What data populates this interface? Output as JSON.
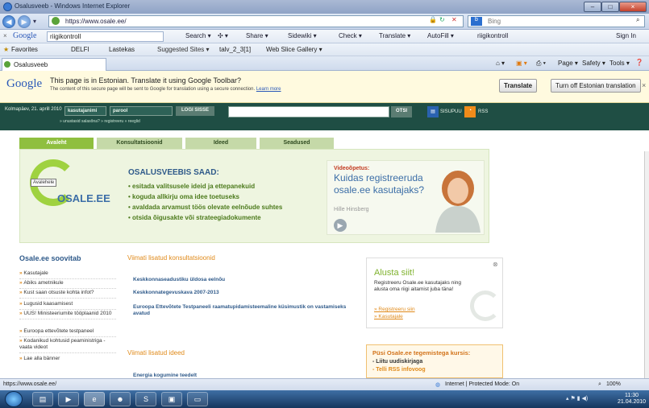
{
  "window": {
    "title": "Osalusveeb - Windows Internet Explorer",
    "minimize": "–",
    "maximize": "□",
    "close": "×"
  },
  "address": {
    "url": "https://www.osale.ee/",
    "search_placeholder": "Bing"
  },
  "google_toolbar": {
    "label": "Google",
    "query": "riigikontroll",
    "items": [
      "Search ▾",
      "✣ ▾",
      "Share ▾",
      "Sidewiki ▾",
      "Check ▾",
      "Translate ▾",
      "AutoFill ▾",
      "riigikontroll"
    ],
    "signin": "Sign In"
  },
  "favorites": {
    "label": "Favorites",
    "items": [
      "DELFI",
      "Lastekas",
      "Suggested Sites ▾",
      "talv_2_3[1]",
      "Web Slice Gallery ▾"
    ]
  },
  "tab": {
    "label": "Osalusveeb"
  },
  "command_bar": {
    "items": [
      "Page ▾",
      "Safety ▾",
      "Tools ▾"
    ]
  },
  "translate_bar": {
    "logo": "Google",
    "message": "This page is in Estonian. Translate it using Google Toolbar?",
    "sub": "The content of this secure page will be sent to Google for translation using a secure connection.",
    "learn_more": "Learn more",
    "translate_btn": "Translate",
    "turnoff_btn": "Turn off Estonian translation"
  },
  "site": {
    "date": "Kolmapäev, 21. aprill 2010",
    "username_label": "kasutajanimi",
    "password_label": "parool",
    "login_btn": "LOGI SISSE",
    "forgot": "» unustasid salasõna?  » registreeru  » reeglid",
    "search_btn": "OTSI",
    "sisupuu": "SISUPUU",
    "rss": "RSS",
    "nav": [
      "Avaleht",
      "Konsultatsioonid",
      "Ideed",
      "Seadused"
    ],
    "logo_tooltip": "Avalehele",
    "logo_text": "OSALE.EE",
    "hero_title": "OSALUSVEEBIS SAAD:",
    "hero_bullets": [
      "esitada valitsusele ideid ja ettepanekuid",
      "koguda allkirju oma idee toetuseks",
      "avaldada arvamust töös olevate eelnõude suhtes",
      "otsida õigusakte või strateegiadokumente"
    ],
    "video_label": "Videoõpetus:",
    "video_title": "Kuidas registreeruda osale.ee kasutajaks?",
    "video_person": "Hille Hinsberg",
    "left_title": "Osale.ee soovitab",
    "left_items": [
      "Kasutajale",
      "Abiks ametnikule",
      "Kust saan otsuste kohta infot?",
      "Lugusid kaasamisest",
      "UUS! Ministeeriumite tööplaanid 2010",
      "Euroopa ettevõtete testpaneel",
      "Kodanikud kohtusid peaministriga - vaata videot",
      "Lae alla bänner"
    ],
    "mid_head1": "Viimati lisatud konsultatsioonid",
    "mid_items1": [
      "Keskkonnaseadustiku üldosa eelnõu",
      "Keskkonnategevuskava 2007-2013",
      "Euroopa Ettevõtete Testpaneeli raamatupidamisteemaline küsimustik on vastamiseks avatud"
    ],
    "mid_head2": "Viimati lisatud ideed",
    "mid_items2": [
      "Energia kogumine teedelt"
    ],
    "right_title": "Alusta siit!",
    "right_text": "Registreeru Osale.ee kasutajaks ning alusta oma riigi aitamist juba täna!",
    "right_links": [
      "» Registreeru siin",
      "» Kasutajale"
    ],
    "rss_title": "Püsi Osale.ee tegemistega kursis:",
    "rss_items": [
      "- Liitu uudiskirjaga",
      "- Telli RSS infovoog"
    ]
  },
  "statusbar": {
    "url": "https://www.osale.ee/",
    "zone": "Internet | Protected Mode: On",
    "zoom": "100%"
  },
  "taskbar": {
    "time": "11:30",
    "date": "21.04.2010"
  }
}
